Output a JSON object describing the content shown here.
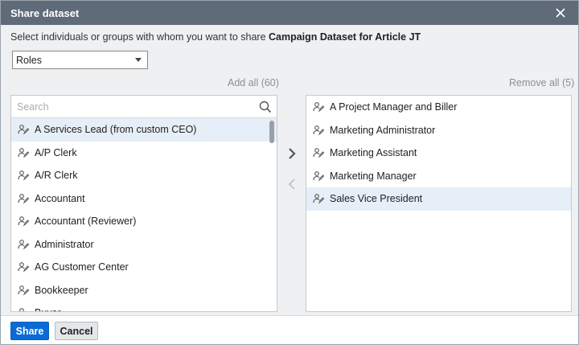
{
  "dialog": {
    "title": "Share dataset",
    "instruction_prefix": "Select individuals or groups with whom you want to share ",
    "dataset_name": "Campaign Dataset for Article JT"
  },
  "type_select": {
    "value": "Roles"
  },
  "available": {
    "add_all_label": "Add all (60)",
    "search_placeholder": "Search",
    "items": [
      {
        "label": "A Services Lead (from custom CEO)",
        "selected": true
      },
      {
        "label": "A/P Clerk"
      },
      {
        "label": "A/R Clerk"
      },
      {
        "label": "Accountant"
      },
      {
        "label": "Accountant (Reviewer)"
      },
      {
        "label": "Administrator"
      },
      {
        "label": "AG Customer Center"
      },
      {
        "label": "Bookkeeper"
      },
      {
        "label": "Buyer"
      }
    ]
  },
  "shared": {
    "remove_all_label": "Remove all (5)",
    "items": [
      {
        "label": "A Project Manager and Biller"
      },
      {
        "label": "Marketing Administrator"
      },
      {
        "label": "Marketing Assistant"
      },
      {
        "label": "Marketing Manager"
      },
      {
        "label": "Sales Vice President",
        "selected": true
      }
    ]
  },
  "footer": {
    "share_label": "Share",
    "cancel_label": "Cancel"
  },
  "colors": {
    "titlebar": "#5f6b78",
    "primary_button": "#0b6bd4",
    "selected_row": "#e6eef8"
  }
}
